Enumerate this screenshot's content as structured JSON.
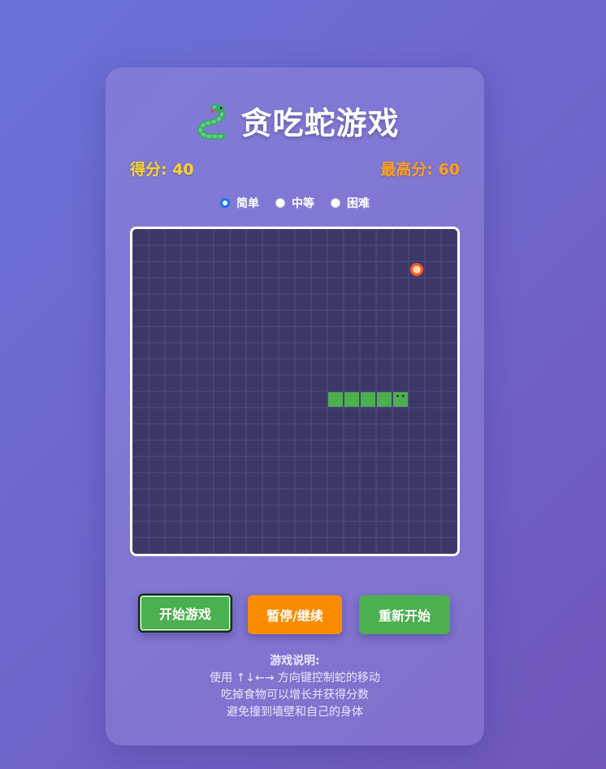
{
  "header": {
    "icon": "snake-icon",
    "title": "贪吃蛇游戏"
  },
  "score": {
    "text": "得分: 40",
    "value": 40
  },
  "high_score": {
    "text": "最高分: 60",
    "value": 60
  },
  "difficulty": {
    "options": [
      "简单",
      "中等",
      "困难"
    ],
    "selected": "简单"
  },
  "board": {
    "grid_cols": 20,
    "grid_rows": 20,
    "snake": [
      [
        12,
        10
      ],
      [
        13,
        10
      ],
      [
        14,
        10
      ],
      [
        15,
        10
      ],
      [
        16,
        10
      ]
    ],
    "snake_head": [
      16,
      10
    ],
    "food": [
      17,
      2
    ],
    "colors": {
      "background": "#3b3766",
      "grid_line": "#524d80",
      "snake": "#4caf50",
      "food": "#ff5722"
    }
  },
  "buttons": {
    "start": "开始游戏",
    "pause": "暂停/继续",
    "restart": "重新开始"
  },
  "instructions": {
    "heading": "游戏说明:",
    "lines": [
      "使用 ↑↓←→ 方向键控制蛇的移动",
      "吃掉食物可以增长并获得分数",
      "避免撞到墙壁和自己的身体"
    ]
  }
}
